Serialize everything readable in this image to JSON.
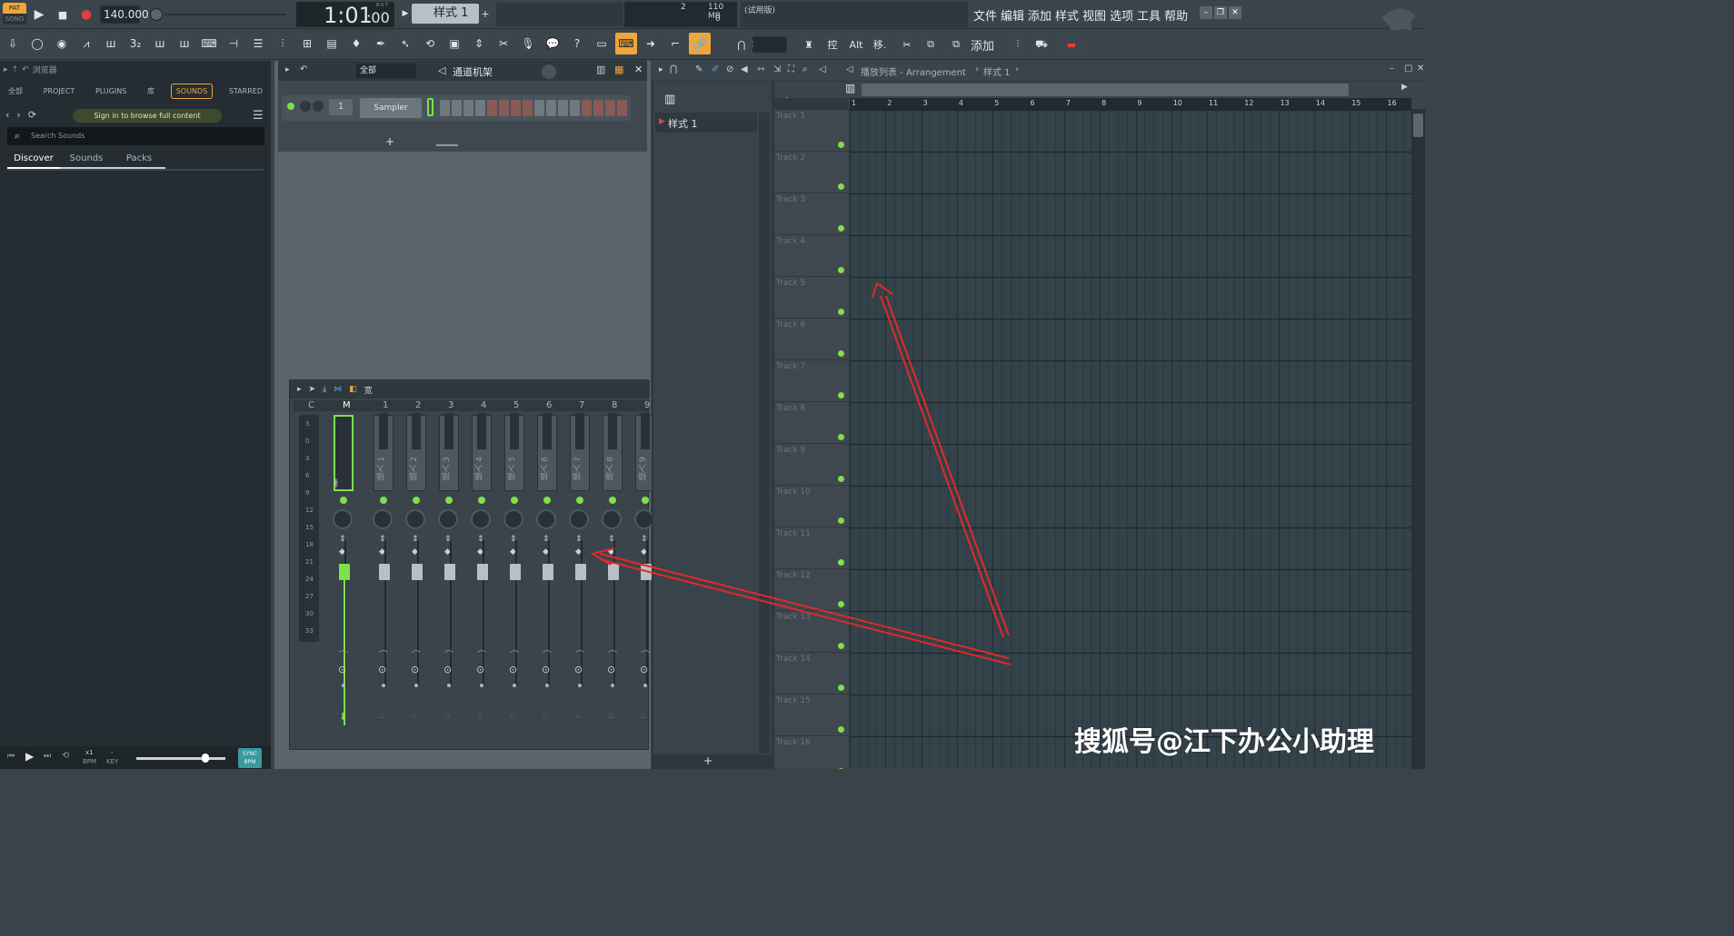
{
  "transport": {
    "pat_label": "PAT",
    "song_label": "SONG",
    "tempo": "140.000",
    "time_display": "1:01",
    "time_sub": ":00",
    "time_unit": "B:S:T",
    "pattern_name": "样式 1",
    "memory": "110 MB",
    "cpu_num": "2",
    "voices": "0",
    "hint_text": "(试用版)"
  },
  "menu": [
    "文件",
    "编辑",
    "添加",
    "样式",
    "视图",
    "选项",
    "工具",
    "帮助"
  ],
  "toolbar2": {
    "snap_label": "线",
    "add_label": "添加"
  },
  "browser": {
    "title": "浏览器",
    "tabs": [
      "全部",
      "PROJECT",
      "PLUGINS",
      "库",
      "SOUNDS",
      "STARRED"
    ],
    "active_tab": "SOUNDS",
    "signin": "Sign in to browse full content",
    "search_placeholder": "Search Sounds",
    "subtabs": [
      "Discover",
      "Sounds",
      "Packs"
    ],
    "active_subtab": "Discover"
  },
  "bottom_bar": {
    "speed": "x1",
    "bpm_label": "BPM",
    "key_label": "KEY",
    "key_value": "-",
    "sync_label": "SYNC",
    "sync_sub": "BPM"
  },
  "channel_rack": {
    "filter": "全部",
    "title": "通道机架",
    "channel_num": "1",
    "channel_name": "Sampler",
    "add": "+"
  },
  "mixer": {
    "title": "宽",
    "header_labels": [
      "C",
      "M",
      "1",
      "2",
      "3",
      "4",
      "5",
      "6",
      "7",
      "8",
      "9"
    ],
    "meter_scale": [
      "3",
      "0",
      "3",
      "6",
      "9",
      "12",
      "15",
      "18",
      "21",
      "24",
      "27",
      "30",
      "33"
    ],
    "insert_labels": [
      "插入 1",
      "插入 2",
      "插入 3",
      "插入 4",
      "插入 5",
      "插入 6",
      "插入 7",
      "插入 8",
      "插入 9"
    ]
  },
  "playlist": {
    "breadcrumb": "播放列表 - Arrangement",
    "pattern": "样式 1",
    "pattern_list_item": "样式 1",
    "ruler": [
      "1",
      "2",
      "3",
      "4",
      "5",
      "6",
      "7",
      "8",
      "9",
      "10",
      "11",
      "12",
      "13",
      "14",
      "15",
      "16"
    ],
    "tracks": [
      "Track 1",
      "Track 2",
      "Track 3",
      "Track 4",
      "Track 5",
      "Track 6",
      "Track 7",
      "Track 8",
      "Track 9",
      "Track 10",
      "Track 11",
      "Track 12",
      "Track 13",
      "Track 14",
      "Track 15",
      "Track 16"
    ],
    "add": "+"
  },
  "watermark": "搜狐号@江下办公小助理",
  "colors": {
    "accent": "#f0a53a",
    "green": "#7ee04a",
    "annotation": "#e02a2a"
  }
}
